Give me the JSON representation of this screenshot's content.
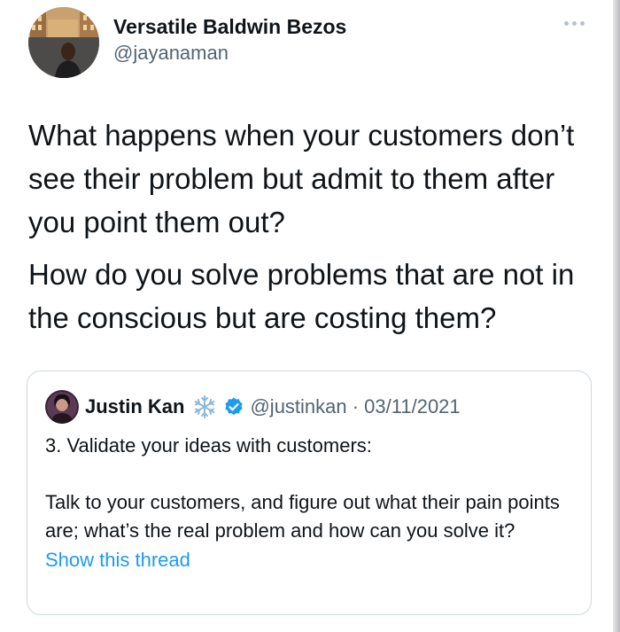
{
  "author": {
    "name": "Versatile Baldwin Bezos",
    "handle": "@jayanaman"
  },
  "tweet": {
    "paragraphs": [
      "What happens when your customers don’t see their problem but admit to them after you point them out?",
      "How do you solve problems that are not in the conscious but are costing them?"
    ]
  },
  "quote": {
    "name": "Justin Kan",
    "handle_date": "@justinkan · 03/11/2021",
    "line1": "3. Validate your ideas with customers:",
    "line2": "Talk to your customers, and figure out what their pain points are; what’s the real problem and how can you solve it?",
    "show_thread": "Show this thread"
  },
  "icons": {
    "more": "more-horizontal-icon",
    "verified": "verified-badge-icon",
    "snowflake": "snowflake-icon"
  },
  "colors": {
    "link": "#1d9bf0",
    "verified": "#1d9bf0",
    "secondary_text": "#536471",
    "border": "#cfd9de"
  }
}
